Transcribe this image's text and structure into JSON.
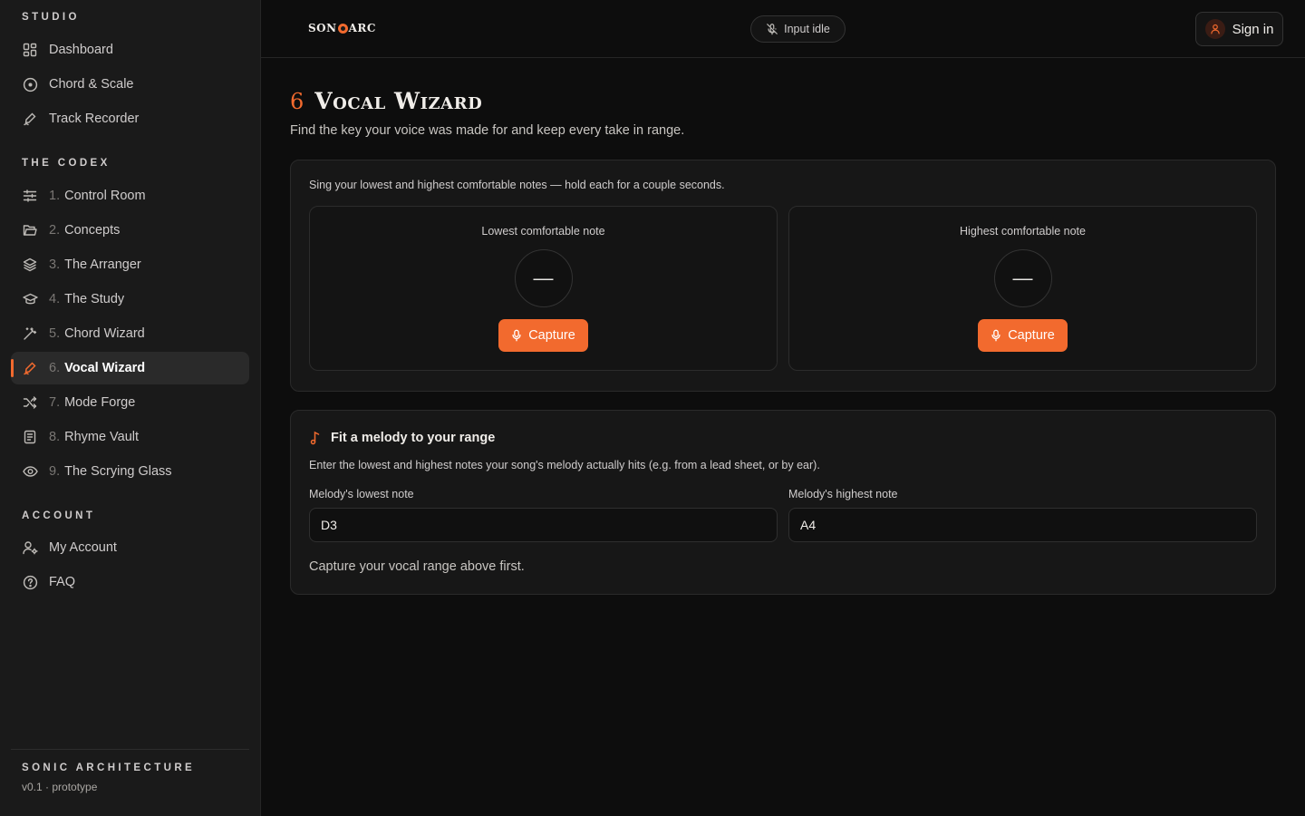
{
  "sidebar": {
    "sections": {
      "studio": "STUDIO",
      "codex": "THE CODEX",
      "account": "ACCOUNT"
    },
    "studio_items": [
      {
        "label": "Dashboard",
        "icon": "grid-icon"
      },
      {
        "label": "Chord & Scale",
        "icon": "target-icon"
      },
      {
        "label": "Track Recorder",
        "icon": "pen-icon"
      }
    ],
    "codex_items": [
      {
        "num": "1.",
        "label": "Control Room",
        "icon": "sliders-icon"
      },
      {
        "num": "2.",
        "label": "Concepts",
        "icon": "folder-icon"
      },
      {
        "num": "3.",
        "label": "The Arranger",
        "icon": "layers-icon"
      },
      {
        "num": "4.",
        "label": "The Study",
        "icon": "graduation-cap-icon"
      },
      {
        "num": "5.",
        "label": "Chord Wizard",
        "icon": "magic-wand-icon"
      },
      {
        "num": "6.",
        "label": "Vocal Wizard",
        "icon": "pen-icon",
        "active": true
      },
      {
        "num": "7.",
        "label": "Mode Forge",
        "icon": "shuffle-icon"
      },
      {
        "num": "8.",
        "label": "Rhyme Vault",
        "icon": "notebook-icon"
      },
      {
        "num": "9.",
        "label": "The Scrying Glass",
        "icon": "eye-icon"
      }
    ],
    "account_items": [
      {
        "label": "My Account",
        "icon": "user-gear-icon"
      },
      {
        "label": "FAQ",
        "icon": "help-circle-icon"
      }
    ],
    "footer": {
      "brand": "SONIC ARCHITECTURE",
      "version": "v0.1 · prototype"
    }
  },
  "topbar": {
    "logo_left": "SON",
    "logo_right": "ARC",
    "status": "Input idle",
    "signin": "Sign in"
  },
  "page": {
    "number": "6",
    "title": "Vocal Wizard",
    "subtitle": "Find the key your voice was made for and keep every take in range."
  },
  "range_card": {
    "intro": "Sing your lowest and highest comfortable notes — hold each for a couple seconds.",
    "low": {
      "label": "Lowest comfortable note",
      "value": "—",
      "button": "Capture"
    },
    "high": {
      "label": "Highest comfortable note",
      "value": "—",
      "button": "Capture"
    }
  },
  "fit_card": {
    "title": "Fit a melody to your range",
    "description": "Enter the lowest and highest notes your song's melody actually hits (e.g. from a lead sheet, or by ear).",
    "low_label": "Melody's lowest note",
    "low_value": "D3",
    "high_label": "Melody's highest note",
    "high_value": "A4",
    "message": "Capture your vocal range above first."
  },
  "colors": {
    "accent": "#f26a2e",
    "background": "#0d0d0d",
    "sidebar": "#1a1a1a"
  }
}
